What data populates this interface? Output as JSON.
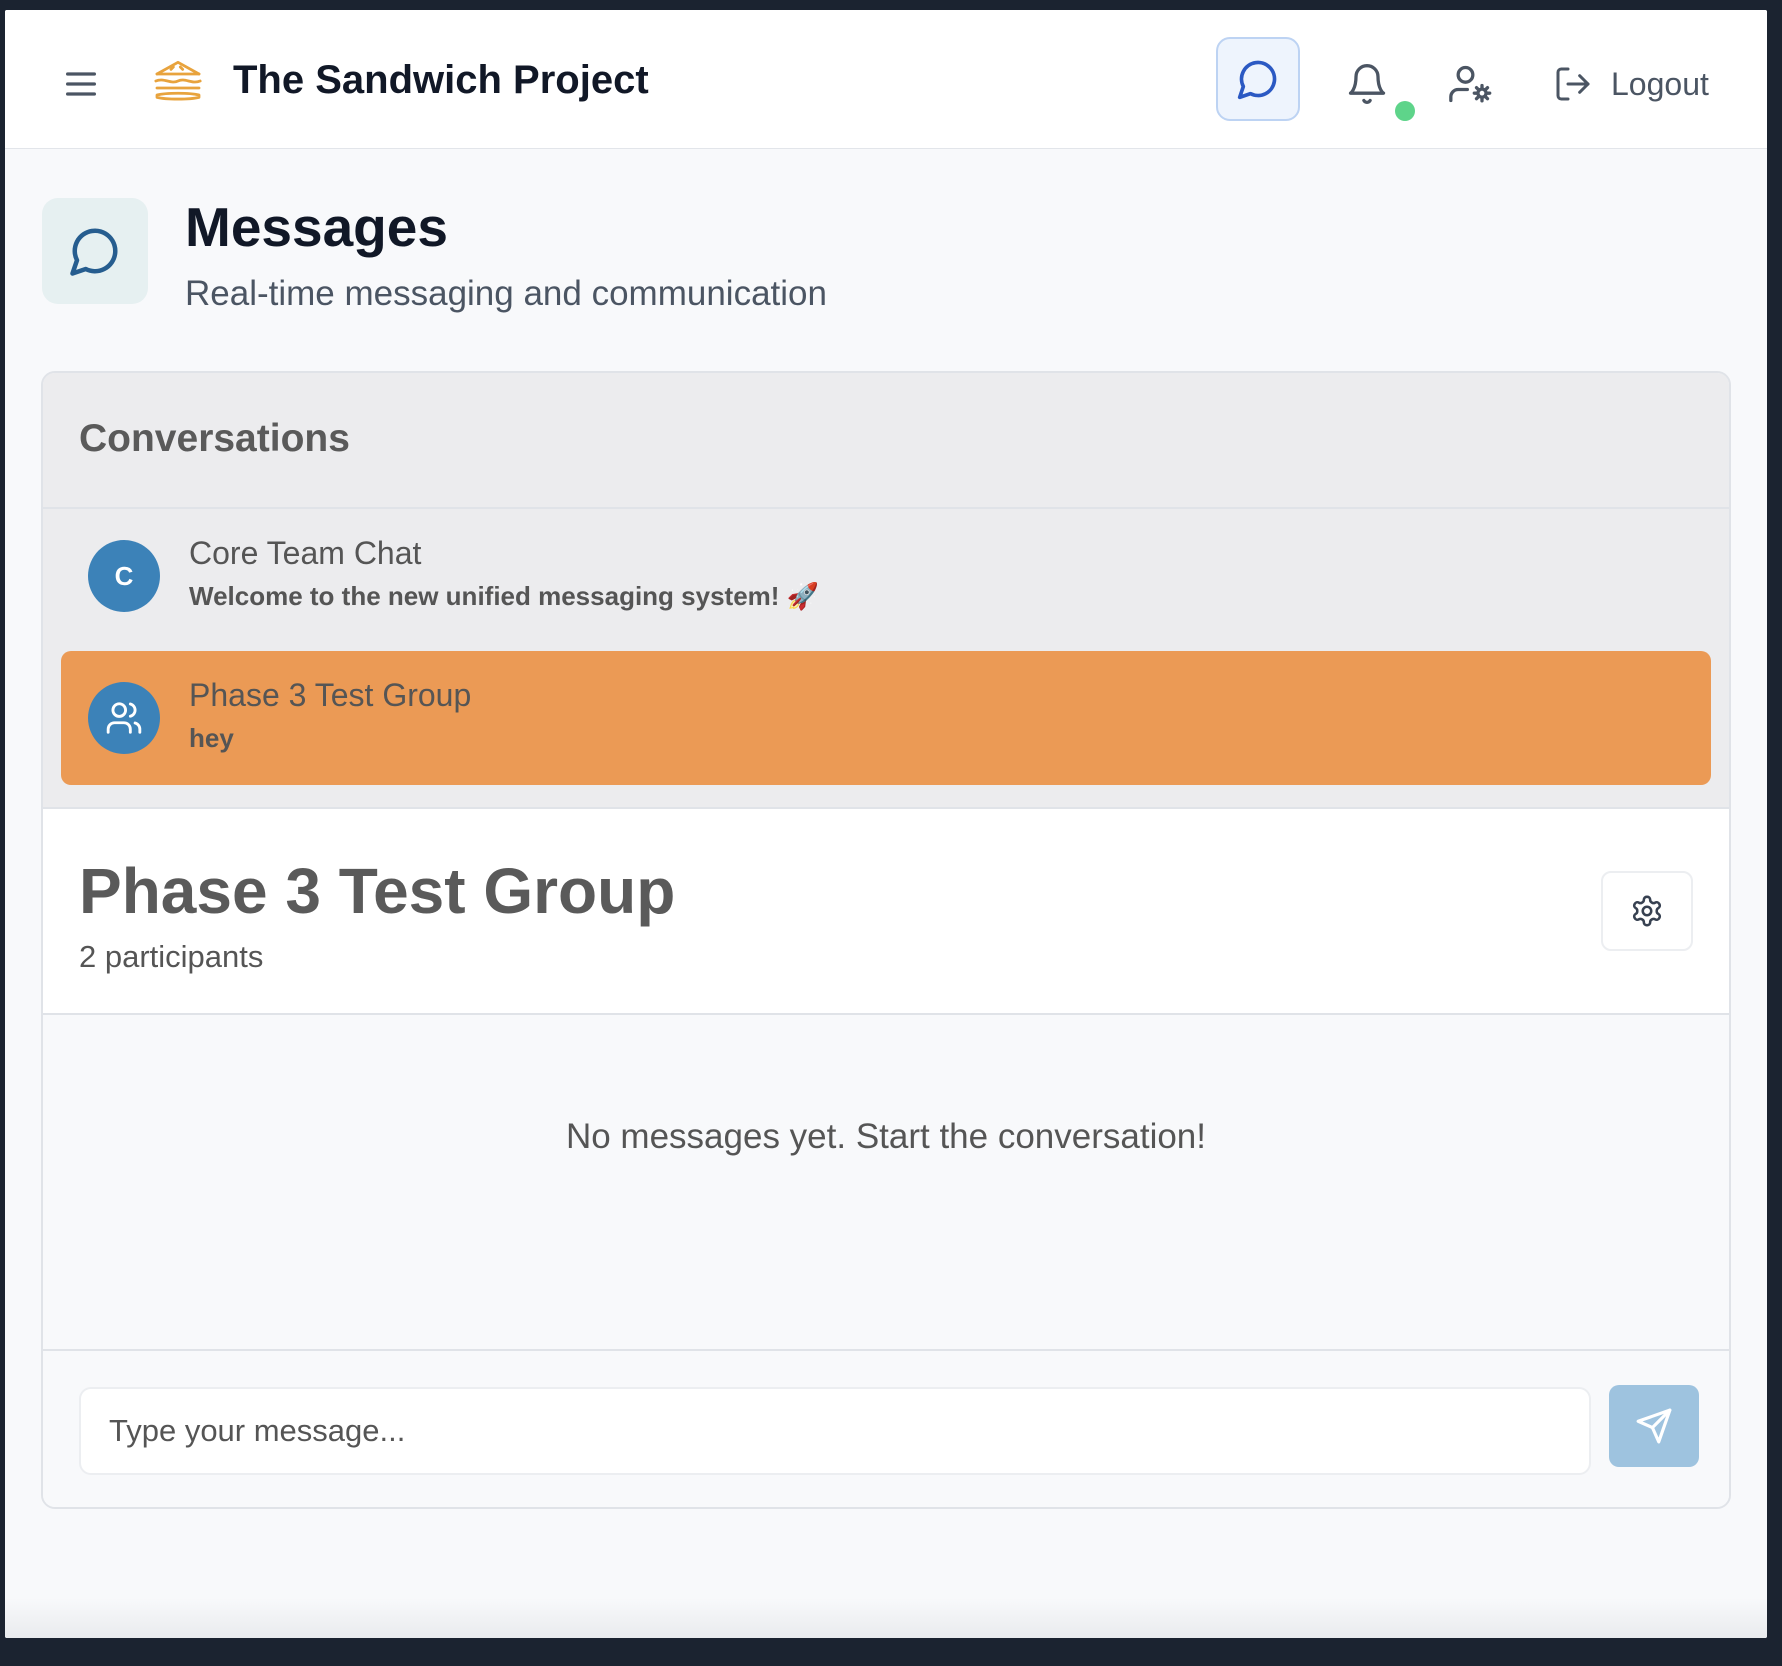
{
  "app": {
    "title": "The Sandwich Project",
    "logout_label": "Logout",
    "brand_color": "#e8a33d",
    "status_dot_color": "#5ed48a"
  },
  "page": {
    "title": "Messages",
    "subtitle": "Real-time messaging and communication"
  },
  "conversations": {
    "heading": "Conversations",
    "items": [
      {
        "name": "Core Team Chat",
        "preview": "Welcome to the new unified messaging system! 🚀",
        "avatar_letter": "C",
        "active": false
      },
      {
        "name": "Phase 3 Test Group",
        "preview": "hey",
        "avatar_icon": "users-icon",
        "active": true
      }
    ],
    "active_color": "#eb9a55"
  },
  "chat": {
    "title": "Phase 3 Test Group",
    "participants": "2 participants",
    "empty_message": "No messages yet. Start the conversation!",
    "input_placeholder": "Type your message..."
  },
  "icons": [
    "menu-icon",
    "sandwich-logo-icon",
    "chat-bubble-icon",
    "bell-icon",
    "user-settings-icon",
    "logout-icon",
    "gear-icon",
    "send-icon",
    "users-icon"
  ]
}
